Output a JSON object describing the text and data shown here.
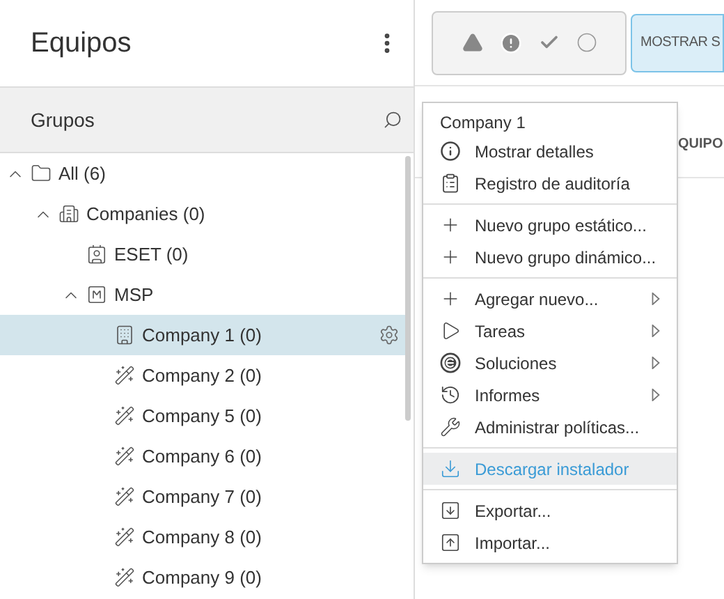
{
  "panel": {
    "title": "Equipos",
    "search_label": "Grupos"
  },
  "tree": [
    {
      "label": "All (6)",
      "kind": "folder",
      "expanded": true,
      "selected": false,
      "children": [
        {
          "label": "Companies (0)",
          "kind": "companies",
          "expanded": true,
          "selected": false,
          "children": [
            {
              "label": "ESET (0)",
              "kind": "eset",
              "selected": false
            },
            {
              "label": "MSP",
              "kind": "msp",
              "expanded": true,
              "selected": false,
              "children": [
                {
                  "label": "Company 1 (0)",
                  "kind": "static",
                  "selected": true
                },
                {
                  "label": "Company 2 (0)",
                  "kind": "dynamic",
                  "selected": false
                },
                {
                  "label": "Company 5 (0)",
                  "kind": "dynamic",
                  "selected": false
                },
                {
                  "label": "Company 6 (0)",
                  "kind": "dynamic",
                  "selected": false
                },
                {
                  "label": "Company 7 (0)",
                  "kind": "dynamic",
                  "selected": false
                },
                {
                  "label": "Company 8 (0)",
                  "kind": "dynamic",
                  "selected": false
                },
                {
                  "label": "Company 9 (0)",
                  "kind": "dynamic",
                  "selected": false
                }
              ]
            }
          ]
        }
      ]
    }
  ],
  "toolbar": {
    "button": "MOSTRAR S",
    "column_1": "QUIPO"
  },
  "context_menu": {
    "title": "Company 1",
    "groups": [
      [
        {
          "label": "Mostrar detalles",
          "kind": "info",
          "submenu": false,
          "highlighted": false
        },
        {
          "label": "Registro de auditoría",
          "kind": "clipboard",
          "submenu": false,
          "highlighted": false
        }
      ],
      [
        {
          "label": "Nuevo grupo estático...",
          "kind": "plus",
          "submenu": false,
          "highlighted": false
        },
        {
          "label": "Nuevo grupo dinámico...",
          "kind": "plus",
          "submenu": false,
          "highlighted": false
        }
      ],
      [
        {
          "label": "Agregar nuevo...",
          "kind": "plus",
          "submenu": true,
          "highlighted": false
        },
        {
          "label": "Tareas",
          "kind": "play",
          "submenu": true,
          "highlighted": false
        },
        {
          "label": "Soluciones",
          "kind": "badge",
          "submenu": true,
          "highlighted": false
        },
        {
          "label": "Informes",
          "kind": "history",
          "submenu": true,
          "highlighted": false
        },
        {
          "label": "Administrar políticas...",
          "kind": "wrench",
          "submenu": false,
          "highlighted": false
        }
      ],
      [
        {
          "label": "Descargar instalador",
          "kind": "download",
          "submenu": false,
          "highlighted": true
        }
      ],
      [
        {
          "label": "Exportar...",
          "kind": "export",
          "submenu": false,
          "highlighted": false
        },
        {
          "label": "Importar...",
          "kind": "import",
          "submenu": false,
          "highlighted": false
        }
      ]
    ]
  }
}
